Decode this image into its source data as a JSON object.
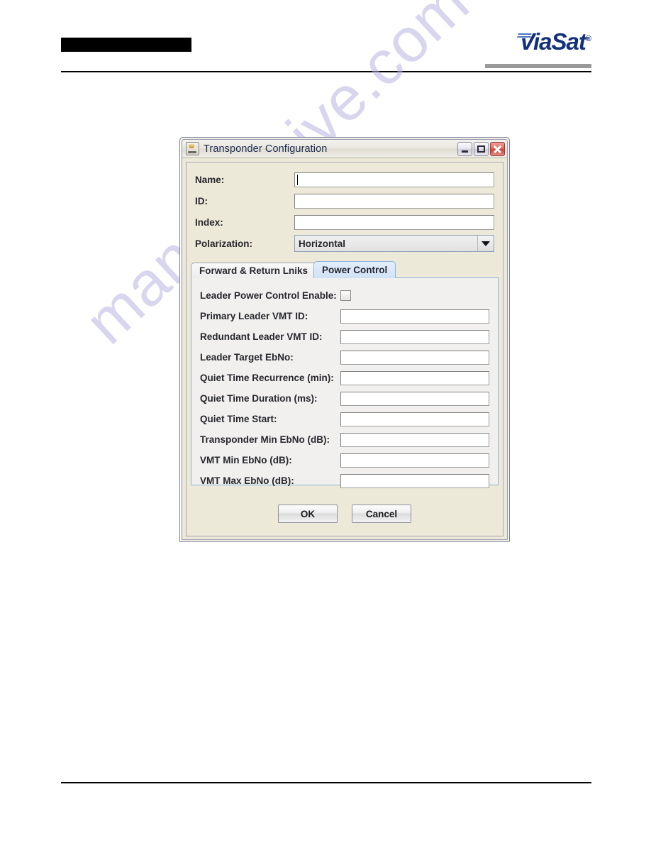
{
  "page": {
    "header": {
      "redaction_bar": "",
      "logo": {
        "wordmark": "ViaSat",
        "registered_mark": "®",
        "color": "#13307a",
        "underbar_color": "#9a9a9a"
      }
    },
    "watermark": {
      "text": "manualshive.com",
      "color": "#b9b5e2"
    }
  },
  "dialog": {
    "title": "Transponder Configuration",
    "icon": "java-coffee-cup-icon",
    "window_buttons": [
      {
        "name": "minimize",
        "glyph": "minimize-icon"
      },
      {
        "name": "maximize",
        "glyph": "maximize-icon"
      },
      {
        "name": "close",
        "glyph": "close-icon"
      }
    ],
    "top_fields": [
      {
        "label": "Name:",
        "value": "",
        "type": "text",
        "focused": true
      },
      {
        "label": "ID:",
        "value": "",
        "type": "text",
        "focused": false
      },
      {
        "label": "Index:",
        "value": "",
        "type": "text",
        "focused": false
      },
      {
        "label": "Polarization:",
        "value": "Horizontal",
        "type": "combo",
        "focused": false
      }
    ],
    "tabs": [
      {
        "label": "Forward & Return Lniks",
        "active": false
      },
      {
        "label": "Power Control",
        "active": true
      }
    ],
    "power_control": {
      "checkbox_row": {
        "label": "Leader Power Control Enable:",
        "checked": false
      },
      "fields": [
        {
          "label": "Primary Leader VMT ID:",
          "value": ""
        },
        {
          "label": "Redundant Leader VMT ID:",
          "value": ""
        },
        {
          "label": "Leader Target EbNo:",
          "value": ""
        },
        {
          "label": "Quiet Time Recurrence (min):",
          "value": ""
        },
        {
          "label": "Quiet Time Duration (ms):",
          "value": ""
        },
        {
          "label": "Quiet Time Start:",
          "value": ""
        },
        {
          "label": "Transponder Min EbNo (dB):",
          "value": ""
        },
        {
          "label": "VMT Min EbNo (dB):",
          "value": ""
        },
        {
          "label": "VMT Max EbNo (dB):",
          "value": ""
        }
      ]
    },
    "buttons": [
      {
        "label": "OK",
        "name": "ok-button"
      },
      {
        "label": "Cancel",
        "name": "cancel-button"
      }
    ]
  }
}
